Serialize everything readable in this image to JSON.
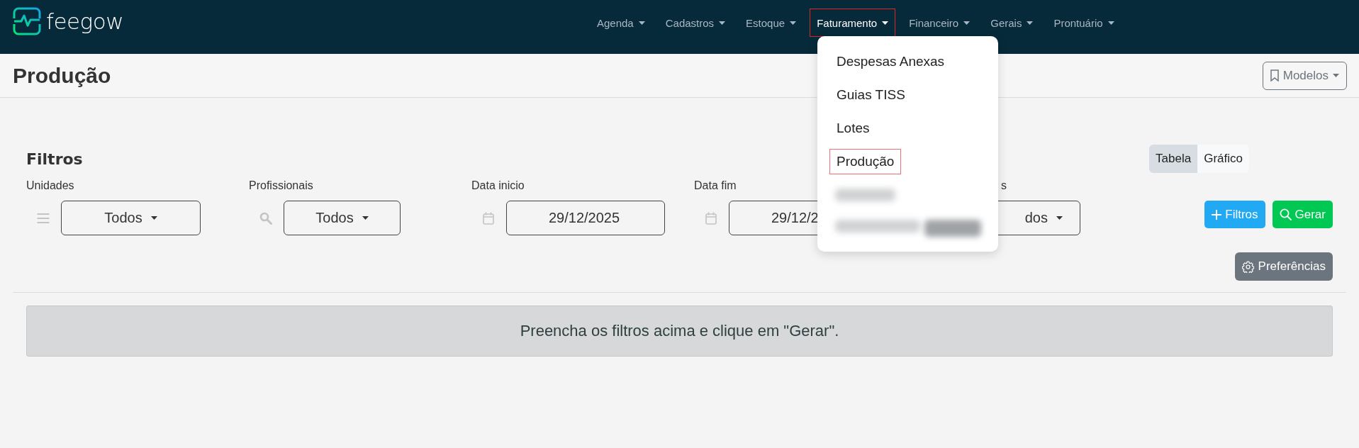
{
  "brand": {
    "name": "feegow"
  },
  "nav": [
    {
      "label": "Agenda",
      "selected": false,
      "highlighted": false
    },
    {
      "label": "Cadastros",
      "selected": false,
      "highlighted": false
    },
    {
      "label": "Estoque",
      "selected": false,
      "highlighted": false
    },
    {
      "label": "Faturamento",
      "selected": true,
      "highlighted": true
    },
    {
      "label": "Financeiro",
      "selected": false,
      "highlighted": false
    },
    {
      "label": "Gerais",
      "selected": false,
      "highlighted": false
    },
    {
      "label": "Prontuário",
      "selected": false,
      "highlighted": false
    }
  ],
  "menu": [
    {
      "kind": "link",
      "label": "Despesas Anexas",
      "highlighted": false
    },
    {
      "kind": "link",
      "label": "Guias TISS",
      "highlighted": false
    },
    {
      "kind": "link",
      "label": "Lotes",
      "highlighted": false
    },
    {
      "kind": "link",
      "label": "Produção",
      "highlighted": true
    },
    {
      "kind": "redacted"
    },
    {
      "kind": "redacted"
    }
  ],
  "page": {
    "title": "Produção",
    "models_button": "Modelos"
  },
  "filters": {
    "title": "Filtros",
    "view_tabs": [
      {
        "label": "Tabela",
        "selected": true
      },
      {
        "label": "Gráfico",
        "selected": false
      }
    ],
    "fields": [
      {
        "kind": "select",
        "label": "Unidades",
        "value": "Todos"
      },
      {
        "kind": "select",
        "label": "Profissionais",
        "value": "Todos"
      },
      {
        "kind": "date",
        "label": "Data inicio",
        "value": "29/12/2025"
      },
      {
        "kind": "date",
        "label": "Data fim",
        "value": "29/12/2"
      },
      {
        "kind": "select",
        "label": "s",
        "value": "dos"
      }
    ],
    "buttons": [
      {
        "kind": "add",
        "label": "Filtros"
      },
      {
        "kind": "search",
        "label": "Gerar"
      }
    ],
    "preferences_button": "Preferências"
  },
  "notice": "Preencha os filtros acima e clique em \"Gerar\"."
}
